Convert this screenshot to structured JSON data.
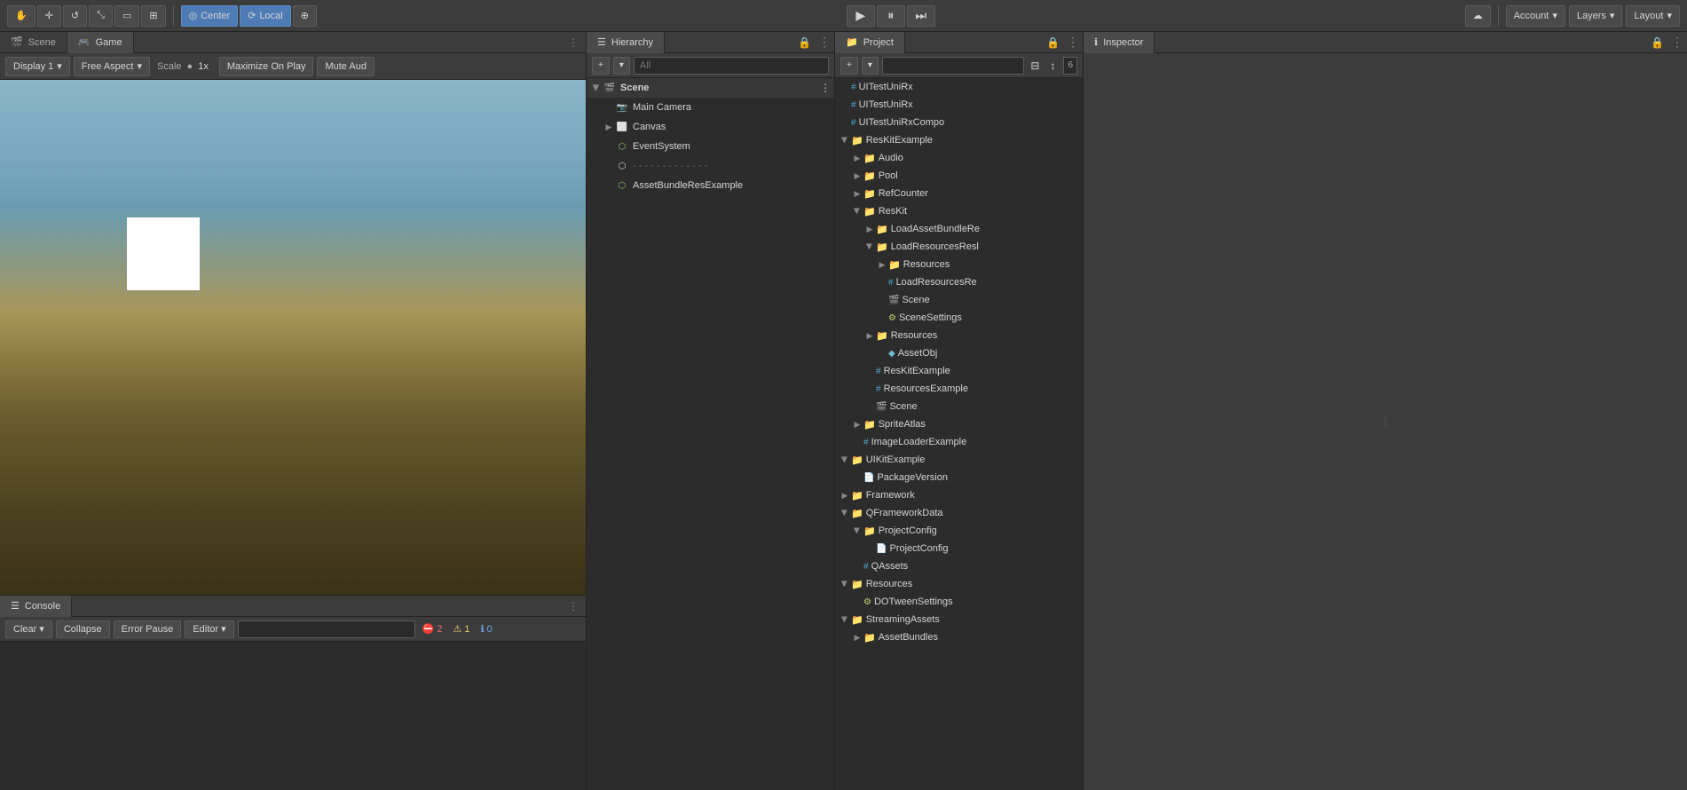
{
  "topbar": {
    "tools": [
      "hand-tool",
      "move-tool",
      "rotate-tool",
      "scale-tool",
      "rect-tool",
      "transform-tool"
    ],
    "center_label": "Center",
    "local_label": "Local",
    "pivot_icon": "⊕",
    "play_button": "▶",
    "pause_button": "⏸",
    "step_button": "⏭",
    "cloud_icon": "☁",
    "account_label": "Account",
    "layers_label": "Layers",
    "layout_label": "Layout"
  },
  "scene_tab": {
    "label": "Scene",
    "icon": "🎬"
  },
  "game_tab": {
    "label": "Game",
    "icon": "🎮"
  },
  "game_toolbar": {
    "display_label": "Display 1",
    "aspect_label": "Free Aspect",
    "scale_label": "Scale",
    "scale_value": "1x",
    "maximize_label": "Maximize On Play",
    "mute_label": "Mute Aud"
  },
  "hierarchy": {
    "panel_label": "Hierarchy",
    "search_placeholder": "All",
    "items": [
      {
        "label": "Scene",
        "depth": 0,
        "expanded": true,
        "type": "scene",
        "has_menu": true
      },
      {
        "label": "Main Camera",
        "depth": 1,
        "expanded": false,
        "type": "camera"
      },
      {
        "label": "Canvas",
        "depth": 1,
        "expanded": false,
        "type": "canvas"
      },
      {
        "label": "EventSystem",
        "depth": 1,
        "expanded": false,
        "type": "gameobj"
      },
      {
        "label": "- - - - - - - - - - - - -",
        "depth": 1,
        "expanded": false,
        "type": "separator"
      },
      {
        "label": "AssetBundleResExample",
        "depth": 1,
        "expanded": false,
        "type": "gameobj"
      }
    ]
  },
  "project": {
    "panel_label": "Project",
    "search_placeholder": "",
    "items": [
      {
        "label": "UITestUniRx",
        "depth": 0,
        "type": "cs",
        "expanded": false
      },
      {
        "label": "UITestUniRx",
        "depth": 0,
        "type": "cs",
        "expanded": false
      },
      {
        "label": "UITestUniRxCompo",
        "depth": 0,
        "type": "cs",
        "expanded": false
      },
      {
        "label": "ResKitExample",
        "depth": 0,
        "type": "folder",
        "expanded": true
      },
      {
        "label": "Audio",
        "depth": 1,
        "type": "folder",
        "expanded": false
      },
      {
        "label": "Pool",
        "depth": 1,
        "type": "folder",
        "expanded": false
      },
      {
        "label": "RefCounter",
        "depth": 1,
        "type": "folder",
        "expanded": false
      },
      {
        "label": "ResKit",
        "depth": 1,
        "type": "folder",
        "expanded": true
      },
      {
        "label": "LoadAssetBundleRe",
        "depth": 2,
        "type": "folder",
        "expanded": false
      },
      {
        "label": "LoadResourcesResl",
        "depth": 2,
        "type": "folder",
        "expanded": true
      },
      {
        "label": "Resources",
        "depth": 3,
        "type": "folder",
        "expanded": false
      },
      {
        "label": "LoadResourcesRe",
        "depth": 3,
        "type": "cs",
        "expanded": false
      },
      {
        "label": "Scene",
        "depth": 3,
        "type": "scene",
        "expanded": false
      },
      {
        "label": "SceneSettings",
        "depth": 3,
        "type": "settings",
        "expanded": false
      },
      {
        "label": "Resources",
        "depth": 2,
        "type": "folder",
        "expanded": false
      },
      {
        "label": "AssetObj",
        "depth": 3,
        "type": "prefab",
        "expanded": false
      },
      {
        "label": "ResKitExample",
        "depth": 2,
        "type": "cs",
        "expanded": false
      },
      {
        "label": "ResourcesExample",
        "depth": 2,
        "type": "cs",
        "expanded": false
      },
      {
        "label": "Scene",
        "depth": 2,
        "type": "scene",
        "expanded": false
      },
      {
        "label": "SpriteAtlas",
        "depth": 1,
        "type": "folder",
        "expanded": false
      },
      {
        "label": "ImageLoaderExample",
        "depth": 1,
        "type": "cs",
        "expanded": false
      },
      {
        "label": "UIKitExample",
        "depth": 0,
        "type": "folder",
        "expanded": true
      },
      {
        "label": "PackageVersion",
        "depth": 1,
        "type": "cs",
        "expanded": false
      },
      {
        "label": "Framework",
        "depth": 0,
        "type": "folder",
        "expanded": false
      },
      {
        "label": "QFrameworkData",
        "depth": 0,
        "type": "folder",
        "expanded": true
      },
      {
        "label": "ProjectConfig",
        "depth": 1,
        "type": "folder",
        "expanded": true
      },
      {
        "label": "ProjectConfig",
        "depth": 2,
        "type": "cs",
        "expanded": false
      },
      {
        "label": "QAssets",
        "depth": 1,
        "type": "cs",
        "expanded": false
      },
      {
        "label": "Resources",
        "depth": 0,
        "type": "folder",
        "expanded": true
      },
      {
        "label": "DOTweenSettings",
        "depth": 1,
        "type": "settings",
        "expanded": false
      },
      {
        "label": "StreamingAssets",
        "depth": 0,
        "type": "folder",
        "expanded": true
      },
      {
        "label": "AssetBundles",
        "depth": 1,
        "type": "folder",
        "expanded": false
      }
    ]
  },
  "inspector": {
    "panel_label": "Inspector"
  },
  "console": {
    "panel_label": "Console",
    "clear_label": "Clear",
    "collapse_label": "Collapse",
    "error_pause_label": "Error Pause",
    "editor_label": "Editor",
    "error_count": "2",
    "warning_count": "1",
    "info_count": "0",
    "error_icon": "⛔",
    "warning_icon": "⚠",
    "info_icon": "ℹ"
  },
  "colors": {
    "bg": "#3c3c3c",
    "panel_bg": "#2c2c2c",
    "active_tab": "#4a4a4a",
    "selected": "#2d5a8e",
    "border": "#232323",
    "accent": "#4f7bb5"
  }
}
